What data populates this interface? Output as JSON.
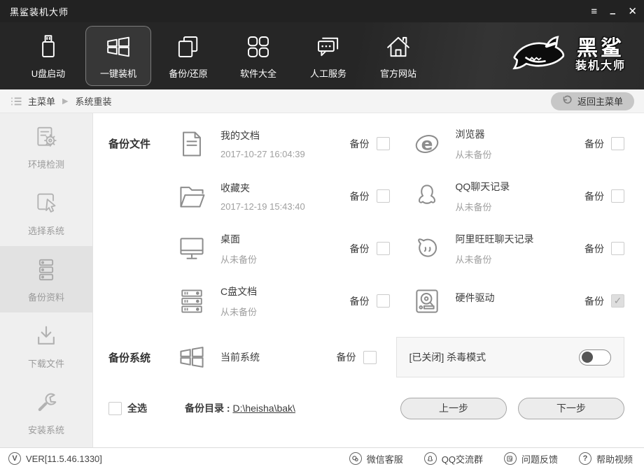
{
  "window": {
    "title": "黑鲨装机大师",
    "controls": {
      "menu": "≡",
      "minimize": "–",
      "close": "✕"
    }
  },
  "nav": {
    "items": [
      {
        "label": "U盘启动"
      },
      {
        "label": "一键装机"
      },
      {
        "label": "备份/还原"
      },
      {
        "label": "软件大全"
      },
      {
        "label": "人工服务"
      },
      {
        "label": "官方网站"
      }
    ],
    "logo_line1": "黑鲨",
    "logo_line2": "装机大师"
  },
  "breadcrumb": {
    "root": "主菜单",
    "separator": "▶",
    "current": "系统重装",
    "back_button": "返回主菜单"
  },
  "sidebar": {
    "items": [
      {
        "label": "环境检测"
      },
      {
        "label": "选择系统"
      },
      {
        "label": "备份资料"
      },
      {
        "label": "下载文件"
      },
      {
        "label": "安装系统"
      }
    ]
  },
  "content": {
    "sections": [
      {
        "label": "备份文件"
      },
      {
        "label": "备份系统"
      }
    ],
    "backup_label": "备份",
    "items": [
      {
        "name": "我的文档",
        "subtitle": "2017-10-27 16:04:39"
      },
      {
        "name": "浏览器",
        "subtitle": "从未备份"
      },
      {
        "name": "收藏夹",
        "subtitle": "2017-12-19 15:43:40"
      },
      {
        "name": "QQ聊天记录",
        "subtitle": "从未备份"
      },
      {
        "name": "桌面",
        "subtitle": "从未备份"
      },
      {
        "name": "阿里旺旺聊天记录",
        "subtitle": "从未备份"
      },
      {
        "name": "C盘文档",
        "subtitle": "从未备份"
      },
      {
        "name": "硬件驱动",
        "subtitle": ""
      },
      {
        "name": "当前系统",
        "subtitle": ""
      }
    ],
    "antivirus": {
      "label": "[已关闭] 杀毒模式",
      "state": "off"
    },
    "select_all_label": "全选",
    "backup_dir_label": "备份目录 : ",
    "backup_dir_value": "D:\\heisha\\bak\\",
    "prev_button": "上一步",
    "next_button": "下一步"
  },
  "footer": {
    "version": "VER[11.5.46.1330]",
    "links": [
      {
        "label": "微信客服"
      },
      {
        "label": "QQ交流群"
      },
      {
        "label": "问题反馈"
      },
      {
        "label": "帮助视频"
      }
    ]
  }
}
